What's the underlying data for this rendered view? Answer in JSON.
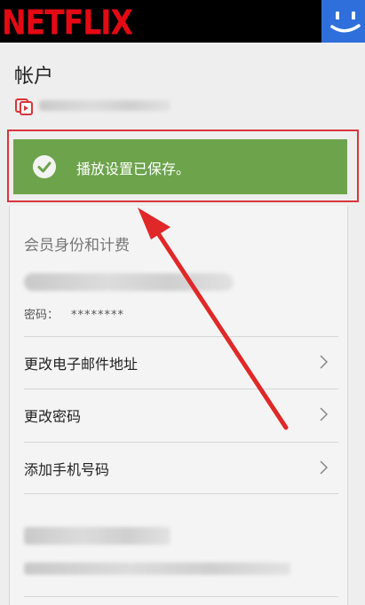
{
  "header": {
    "logo": "NETFLIX"
  },
  "account": {
    "title": "帐户"
  },
  "banner": {
    "message": "播放设置已保存。"
  },
  "membership": {
    "section_title": "会员身份和计费",
    "password_label": "密码：",
    "password_value": "********"
  },
  "links": [
    {
      "label": "更改电子邮件地址"
    },
    {
      "label": "更改密码"
    },
    {
      "label": "添加手机号码"
    }
  ],
  "colors": {
    "brand_red": "#e50914",
    "success_green": "#6ca34b",
    "highlight_red": "#d9343c",
    "profile_blue": "#2f6fdc"
  },
  "icons": [
    "netflix-logo",
    "smiley-profile-icon",
    "member-card-icon",
    "check-circle-icon",
    "chevron-right-icon"
  ]
}
